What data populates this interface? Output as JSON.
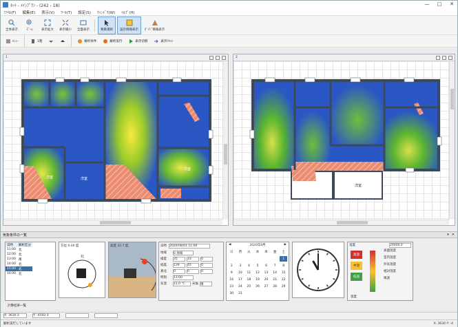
{
  "window": {
    "title": "ﾈｯﾄ - ﾒｲﾝﾌﾟﾗﾝ - (242 - 18)",
    "controls": [
      "—",
      "□",
      "✕"
    ]
  },
  "menu": [
    "ﾌｧｲﾙ(F)",
    "編集(E)",
    "表示(V)",
    "ﾂｰﾙ(T)",
    "設定(S)",
    "ｳｨﾝﾄﾞｳ(W)",
    "ﾍﾙﾌﾟ(H)"
  ],
  "toolbar1": [
    {
      "label": "全体表示",
      "icon": "zoom-fit-icon"
    },
    {
      "label": "ｽﾞｰﾑ",
      "icon": "zoom-icon"
    },
    {
      "label": "表示拡大",
      "icon": "expand-icon"
    },
    {
      "label": "表示縮小",
      "icon": "shrink-icon"
    },
    {
      "label": "全面表示",
      "icon": "fullscreen-icon"
    },
    {
      "label": "要素選択",
      "icon": "cursor-icon",
      "active": true
    },
    {
      "label": "設計情報表示",
      "icon": "info-icon",
      "active": true
    },
    {
      "label": "ｶﾞｲﾄﾞ情報表示",
      "icon": "guide-icon"
    }
  ],
  "toolbar2": [
    {
      "label": "ﾒﾆｭｰ",
      "icon": "list-icon"
    },
    {
      "label": "1階",
      "icon": "floor-icon"
    },
    {
      "label": "",
      "icon": "dropdown-icon"
    },
    {
      "label": "",
      "icon": "up-arrow-icon"
    },
    {
      "label": "解析条件",
      "icon": "gear-icon"
    },
    {
      "label": "解析実行",
      "icon": "run-icon"
    },
    {
      "label": "表示切替",
      "icon": "play-icon"
    },
    {
      "label": "表示ﾘｾｯﾄ",
      "icon": "reset-icon"
    }
  ],
  "views": {
    "left_label": "1",
    "right_label": "2"
  },
  "panel": {
    "title": "気象条件の一覧"
  },
  "list": {
    "headers": [
      "日時",
      "解析区分"
    ],
    "rows": [
      [
        "11:00",
        "北"
      ],
      [
        "12:00",
        "北"
      ],
      [
        "13:00",
        "南"
      ],
      [
        "14:00",
        "北"
      ],
      [
        "15:00",
        "北"
      ],
      [
        "16:00",
        "北"
      ]
    ],
    "footer": "計算結果一覧"
  },
  "sun": {
    "left_title": "方位",
    "left_value": "0.00 度",
    "right_title": "高度",
    "right_value": "32.7 度",
    "north": "北"
  },
  "params": {
    "head_left": "日時",
    "head_right": "2020/08/01 11:00",
    "rows": [
      {
        "label": "地域",
        "v1": "6 地域"
      },
      {
        "label": "緯度",
        "v1": "35",
        "v2": "33",
        "v3": "0"
      },
      {
        "label": "経度",
        "v1": "139",
        "v2": "45",
        "v3": "0"
      },
      {
        "label": "真北",
        "v1": "0",
        "v2": "0",
        "v3": "0"
      },
      {
        "label": "時刻",
        "v1": "11:00",
        "v2": "",
        "v3": ""
      },
      {
        "label": "気温",
        "v1": "11.0 ℃",
        "v2": "天候",
        "v3": "晴"
      }
    ]
  },
  "calendar": {
    "title": "2020年8月",
    "weekdays": [
      "日",
      "月",
      "火",
      "水",
      "木",
      "金",
      "土"
    ],
    "weeks": [
      [
        "",
        "",
        "",
        "",
        "",
        "",
        "1"
      ],
      [
        "2",
        "3",
        "4",
        "5",
        "6",
        "7",
        "8"
      ],
      [
        "9",
        "10",
        "11",
        "12",
        "13",
        "14",
        "15"
      ],
      [
        "16",
        "17",
        "18",
        "19",
        "20",
        "21",
        "22"
      ],
      [
        "23",
        "24",
        "25",
        "26",
        "27",
        "28",
        "29"
      ],
      [
        "30",
        "31",
        "",
        "",
        "",
        "",
        ""
      ]
    ]
  },
  "clock": {
    "hour": 11,
    "minute": 0
  },
  "legend": {
    "title": "温度",
    "value": "20000.0",
    "labels": [
      "高温",
      "中温",
      "低温"
    ],
    "colors": [
      "#d32f2f",
      "#fbc02d",
      "#43a047"
    ],
    "right_title": "凡例",
    "right_items": [
      "表面温度",
      "室内温度",
      "外気温度",
      "相対湿度",
      "風速"
    ],
    "bottom": "温度"
  },
  "status": {
    "x": "X: 3630.3",
    "y": "Y: -4593.3",
    "items": [
      "",
      ""
    ]
  },
  "status2": {
    "left": "解析実行しています",
    "right": "X: 3630  Y: -4"
  },
  "heat_colors": {
    "cold": "#1f4fbf",
    "warm": "#5ab82d",
    "hot": "#f5e04a",
    "brick": "#e8826a"
  }
}
